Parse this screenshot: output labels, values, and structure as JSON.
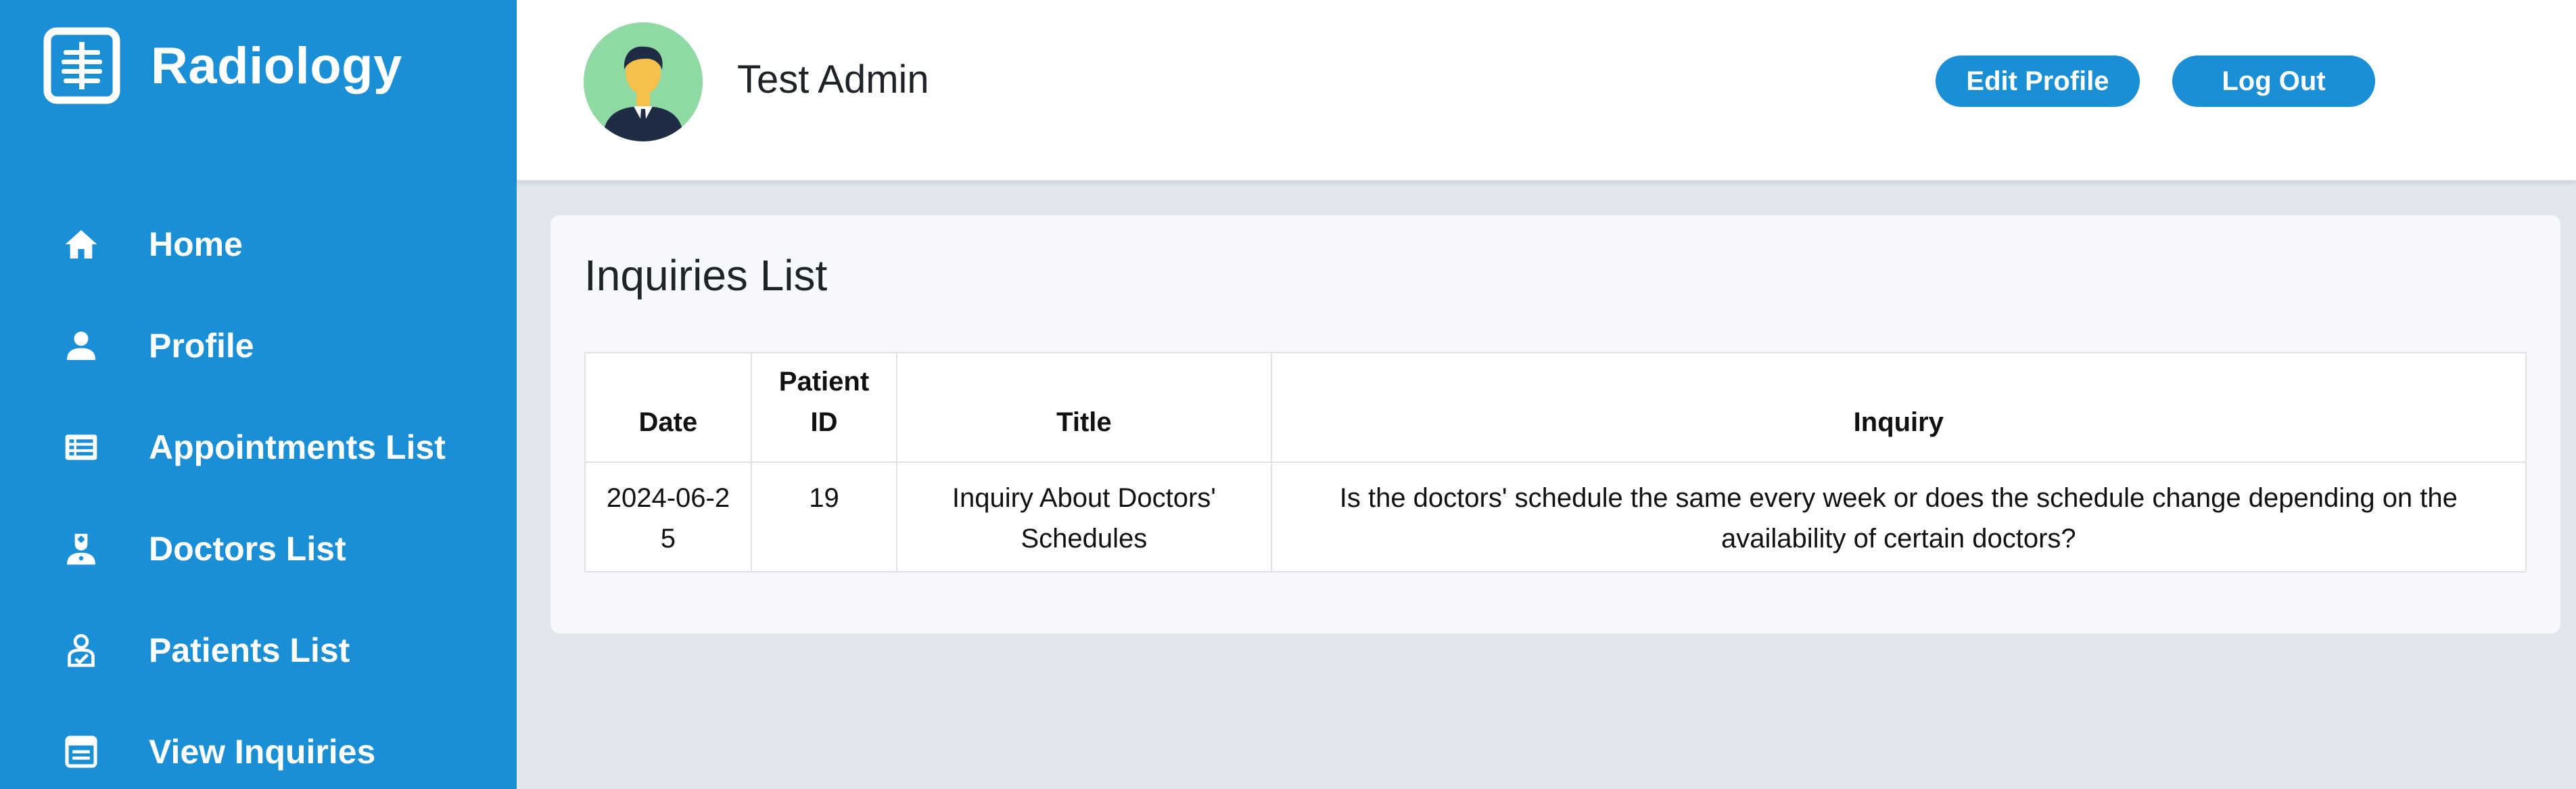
{
  "brand": {
    "name": "Radiology",
    "icon": "xray-icon"
  },
  "sidebar": {
    "items": [
      {
        "label": "Home",
        "icon": "home-icon"
      },
      {
        "label": "Profile",
        "icon": "person-icon"
      },
      {
        "label": "Appointments List",
        "icon": "list-icon"
      },
      {
        "label": "Doctors List",
        "icon": "doctor-icon"
      },
      {
        "label": "Patients List",
        "icon": "patient-icon"
      },
      {
        "label": "View Inquiries",
        "icon": "inquiries-icon"
      }
    ]
  },
  "header": {
    "user_name": "Test Admin",
    "edit_profile_label": "Edit Profile",
    "logout_label": "Log Out"
  },
  "main": {
    "title": "Inquiries List",
    "table": {
      "columns": [
        "Date",
        "Patient ID",
        "Title",
        "Inquiry"
      ],
      "rows": [
        {
          "date": "2024-06-25",
          "patient_id": "19",
          "title": "Inquiry About Doctors' Schedules",
          "inquiry": "Is the doctors' schedule the same every week or does the schedule change depending on the availability of certain doctors?"
        }
      ]
    }
  },
  "colors": {
    "accent": "#1a8fd6",
    "background": "#e2e7ef",
    "card": "#f6f8fb",
    "avatar_bg": "#8fd9a4"
  }
}
